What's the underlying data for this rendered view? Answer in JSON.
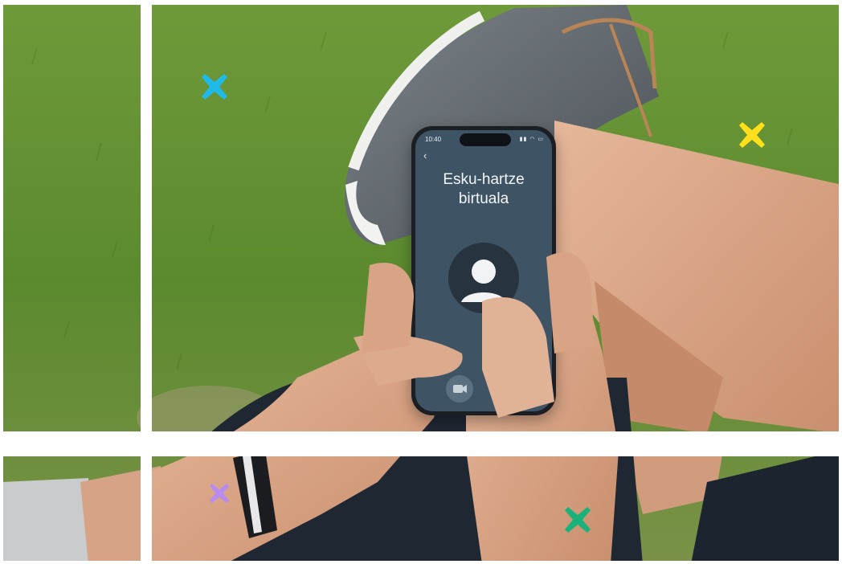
{
  "phone": {
    "status_time": "10:40",
    "status_icons": "▮▮ ◠ ▭",
    "back_glyph": "‹",
    "title_line1": "Esku-hartze",
    "title_line2": "birtuala"
  },
  "markers": [
    {
      "name": "cyan-x-marker",
      "color": "#1ebbea"
    },
    {
      "name": "yellow-x-marker",
      "color": "#ffe01a"
    },
    {
      "name": "purple-x-marker",
      "color": "#b98bf0"
    },
    {
      "name": "green-x-marker",
      "color": "#1bb27a"
    }
  ]
}
